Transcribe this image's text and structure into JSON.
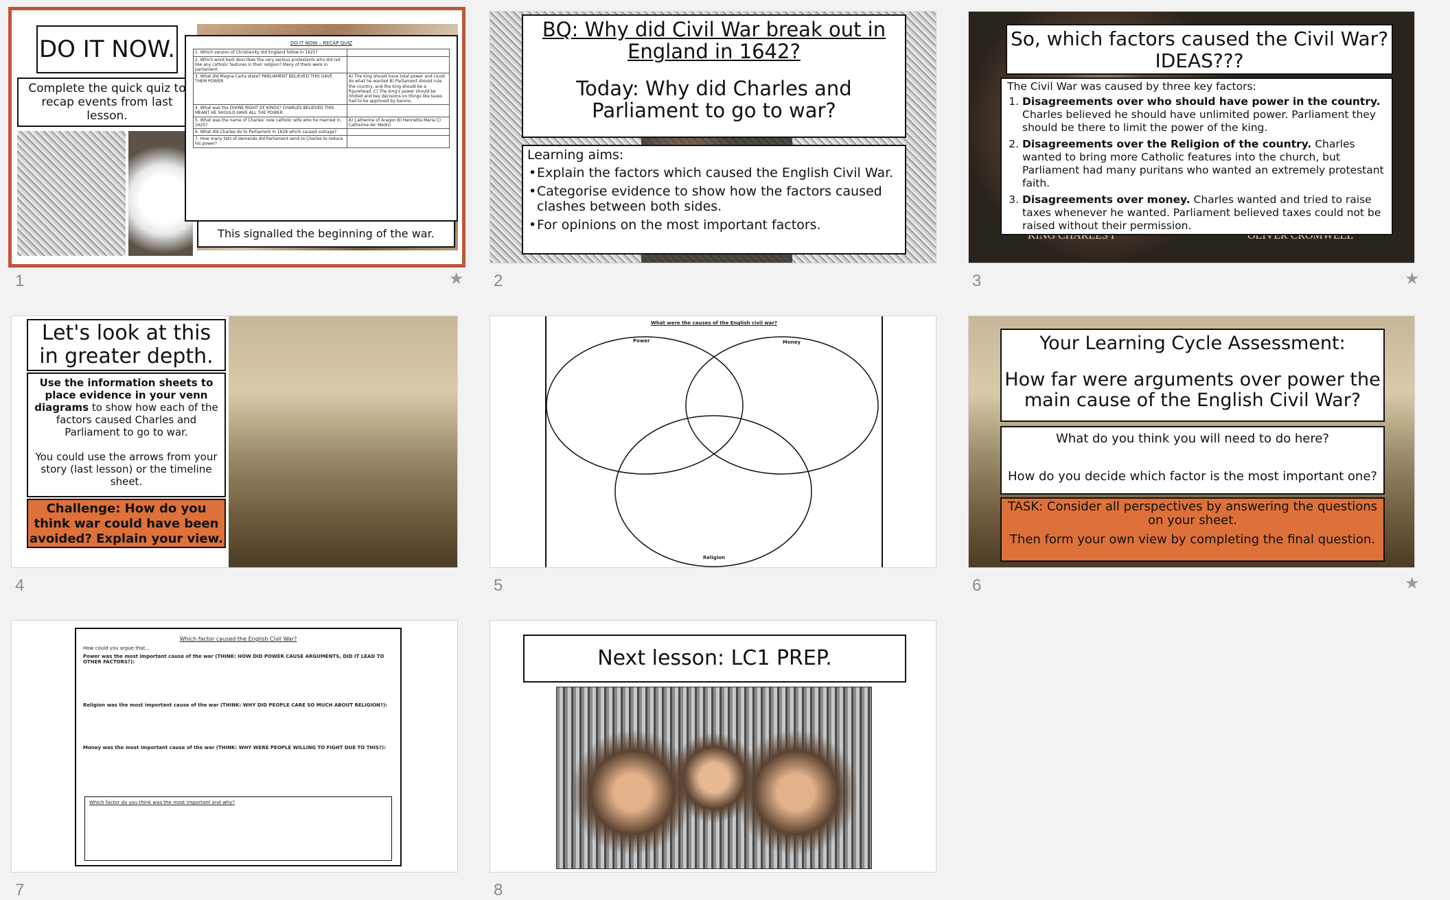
{
  "slides": [
    {
      "number": "1",
      "title": "DO IT NOW.",
      "instruction": "Complete the quick quiz to recap events from last lesson.",
      "caption": "This signalled the beginning of the war.",
      "quiz_title": "DO IT NOW – RECAP QUIZ",
      "quiz_rows": [
        {
          "q": "1. Which version of Christianity did England follow in 1625?",
          "a": ""
        },
        {
          "q": "2. Which word best describes the very serious protestants who did not like any catholic features in their religion? Many of them were in parliament.",
          "a": ""
        },
        {
          "q": "3. What did Magna Carta state? PARLIAMENT BELIEVED THIS GAVE THEM POWER.",
          "a": "A) The king should have total power and could do what he wanted B) Parliament should rule the country, and the king should be a figurehead. C) The king's power should be limited and key decisions on things like taxes had to be approved by barons."
        },
        {
          "q": "4. What was the DIVINE RIGHT OF KINGS? CHARLES BELIEVED THIS MEANT HE SHOULD HAVE ALL THE POWER.",
          "a": ""
        },
        {
          "q": "5. What was the name of Charles' new catholic wife who he married in 1625?",
          "a": "A) Catherine of Aragon B) Henrietta Maria C) Catherine de' Medici"
        },
        {
          "q": "6. What did Charles do to Parliament in 1629 which caused outrage?",
          "a": ""
        },
        {
          "q": "7. How many lists of demands did Parliament send to Charles to reduce his power?",
          "a": ""
        }
      ]
    },
    {
      "number": "2",
      "bq": "BQ: Why did Civil War break out in England in 1642?",
      "today": "Today: Why did Charles and Parliament to go to war?",
      "aims_label": "Learning aims:",
      "aims": [
        "Explain the factors which caused the English Civil War.",
        "Categorise evidence to show how the factors caused clashes between both sides.",
        "For opinions on the most important factors."
      ]
    },
    {
      "number": "3",
      "title": "So, which factors caused the Civil War? IDEAS???",
      "intro": "The Civil War was caused by three key factors:",
      "factors": [
        {
          "bold": "Disagreements over who should have power in the country.",
          "text": "Charles believed he should have unlimited power. Parliament they should be there to limit the power of the king."
        },
        {
          "bold": "Disagreements over the Religion of the country.",
          "text": "Charles wanted to bring more Catholic features into the church, but Parliament had many puritans who wanted an extremely protestant faith."
        },
        {
          "bold": "Disagreements over money.",
          "text": "Charles wanted and tried to raise taxes whenever he wanted. Parliament believed taxes could not be raised without their permission."
        }
      ],
      "portrait_left": "KING CHARLES I",
      "portrait_right": "OLIVER CROMWELL"
    },
    {
      "number": "4",
      "title": "Let's look at this in greater depth.",
      "instruction_bold": "Use the information sheets to place evidence in your venn diagrams",
      "instruction_rest": "to show how each of the factors caused Charles and Parliament to go to war.",
      "hint": "You could use the arrows from your story (last lesson) or the timeline sheet.",
      "challenge": "Challenge: How do you think war could have been avoided? Explain your view."
    },
    {
      "number": "5",
      "title": "What were the causes of the English civil war?",
      "labels": [
        "Power",
        "Money",
        "Religion"
      ]
    },
    {
      "number": "6",
      "title": "Your Learning Cycle Assessment:",
      "question": "How far were arguments over power the main cause of the English Civil War?",
      "prompt1": "What do you think you will need to do here?",
      "prompt2": "How do you decide which factor is the most important one?",
      "task1": "TASK: Consider all perspectives by answering the questions on your sheet.",
      "task2": "Then form your own view by completing the final question."
    },
    {
      "number": "7",
      "title": "Which factor caused the English Civil War?",
      "lead": "How could you argue that...",
      "items": [
        "Power was the most important cause of the war (THINK: HOW DID POWER CAUSE ARGUMENTS, DID IT LEAD TO OTHER FACTORS?):",
        "Religion was the most important cause of the war (THINK: WHY DID PEOPLE CARE SO MUCH ABOUT RELIGION?):",
        "Money was the most important cause of the war (THINK: WHY WERE PEOPLE WILLING TO FIGHT DUE TO THIS?):"
      ],
      "final": "Which factor do you think was the most important and why?"
    },
    {
      "number": "8",
      "title": "Next lesson: LC1 PREP."
    }
  ],
  "starred": [
    "1",
    "3",
    "6"
  ],
  "star_glyph": "★",
  "selected": "1",
  "colors": {
    "accent": "#dd7139",
    "selection": "#c0553a"
  }
}
